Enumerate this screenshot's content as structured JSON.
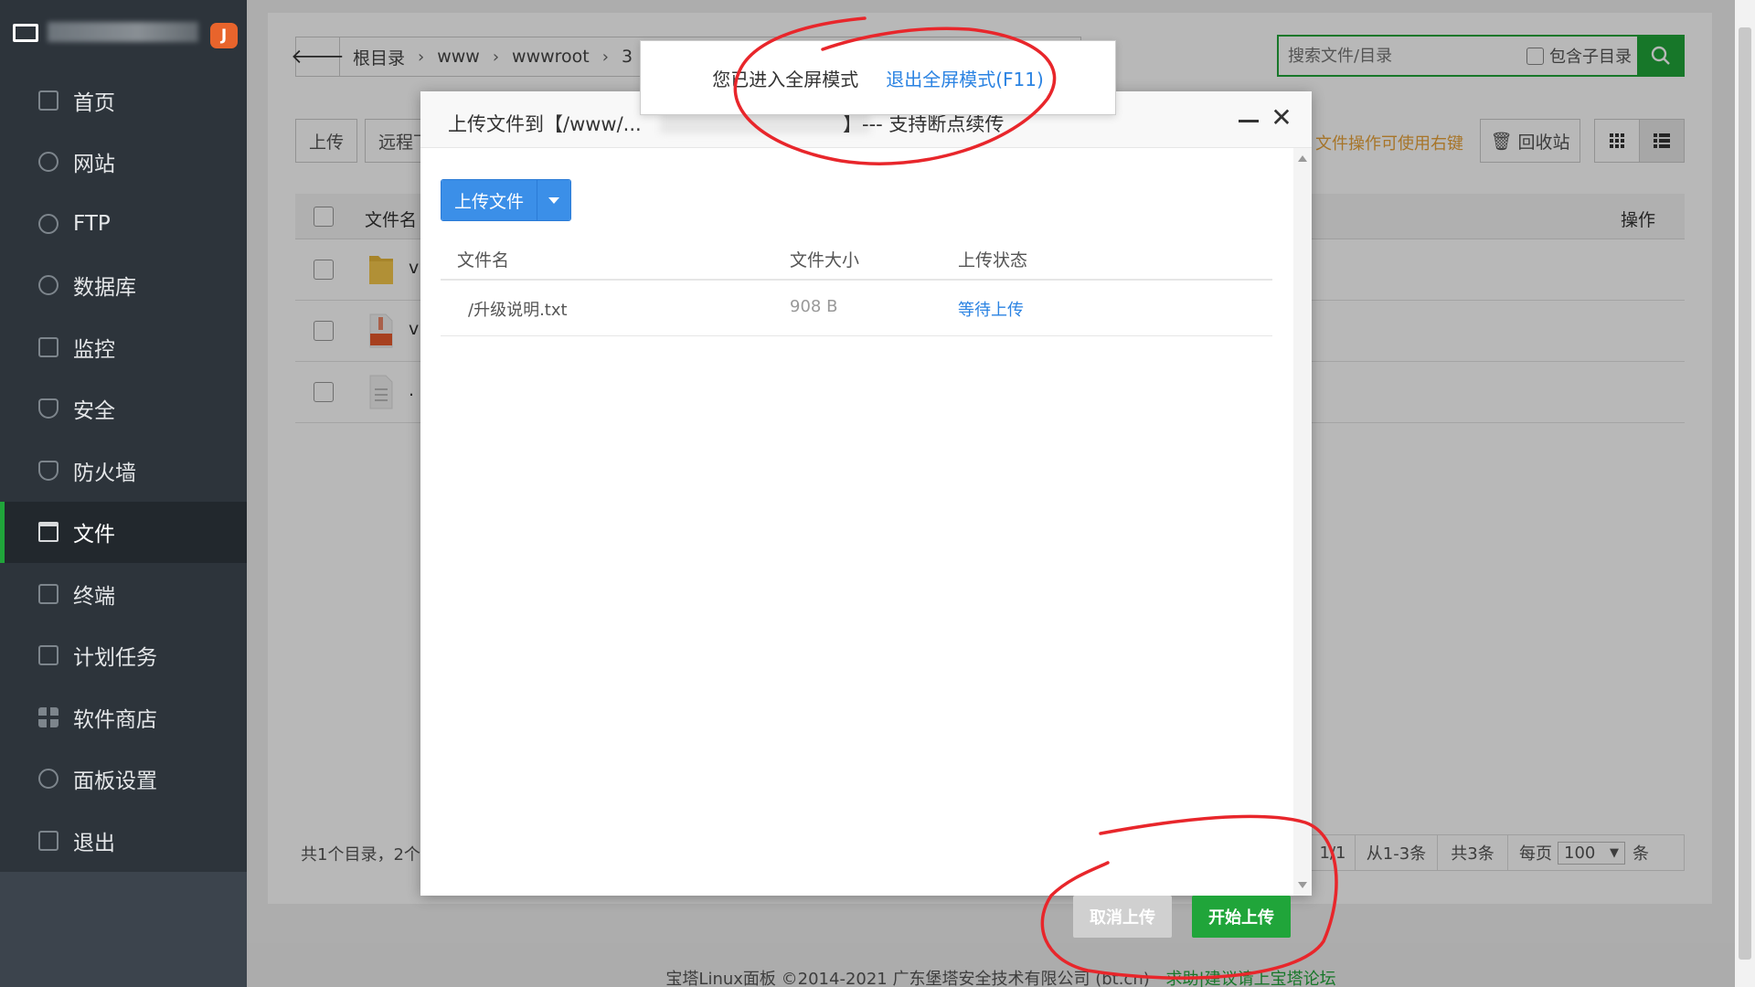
{
  "sidebar": {
    "badge": "J",
    "items": [
      {
        "label": "首页",
        "icon": "home-icon"
      },
      {
        "label": "网站",
        "icon": "globe-icon"
      },
      {
        "label": "FTP",
        "icon": "ftp-icon"
      },
      {
        "label": "数据库",
        "icon": "database-icon"
      },
      {
        "label": "监控",
        "icon": "monitor-chart-icon"
      },
      {
        "label": "安全",
        "icon": "shield-icon"
      },
      {
        "label": "防火墙",
        "icon": "firewall-icon"
      },
      {
        "label": "文件",
        "icon": "folder-icon"
      },
      {
        "label": "终端",
        "icon": "terminal-icon"
      },
      {
        "label": "计划任务",
        "icon": "calendar-icon"
      },
      {
        "label": "软件商店",
        "icon": "grid-icon"
      },
      {
        "label": "面板设置",
        "icon": "gear-icon"
      },
      {
        "label": "退出",
        "icon": "logout-icon"
      }
    ],
    "active_index": 7
  },
  "breadcrumb": {
    "items": [
      "根目录",
      "www",
      "wwwroot",
      "3"
    ]
  },
  "search": {
    "placeholder": "搜索文件/目录",
    "include_subdir": "包含子目录"
  },
  "toolbar": {
    "upload": "上传",
    "remote": "远程下",
    "hint": "文件操作可使用右键",
    "recycle": "回收站"
  },
  "table": {
    "col_name": "文件名",
    "col_action": "操作",
    "rows": [
      {
        "name": "v",
        "type": "folder"
      },
      {
        "name": "v",
        "type": "zip"
      },
      {
        "name": ".",
        "type": "file"
      }
    ]
  },
  "pager": {
    "summary": "共1个目录，2个",
    "page": "1/1",
    "range": "从1-3条",
    "total": "共3条",
    "per_page_label": "每页",
    "per_page_value": "100",
    "unit": "条"
  },
  "footer": {
    "copyright": "宝塔Linux面板 ©2014-2021 广东堡塔安全技术有限公司 (bt.cn)",
    "link": "求助|建议请上宝塔论坛"
  },
  "modal": {
    "title_prefix": "上传文件到【/www/...",
    "title_suffix": "】--- 支持断点续传",
    "upload_button": "上传文件",
    "columns": [
      "文件名",
      "文件大小",
      "上传状态"
    ],
    "files": [
      {
        "name": "/升级说明.txt",
        "size": "908 B",
        "status": "等待上传"
      }
    ],
    "cancel": "取消上传",
    "start": "开始上传"
  },
  "toast": {
    "message": "您已进入全屏模式",
    "exit": "退出全屏模式(F11)"
  },
  "colors": {
    "brand_green": "#20a53a",
    "sidebar": "#3c444d",
    "link_blue": "#2b83e2",
    "annotation_red": "#e8262b"
  }
}
